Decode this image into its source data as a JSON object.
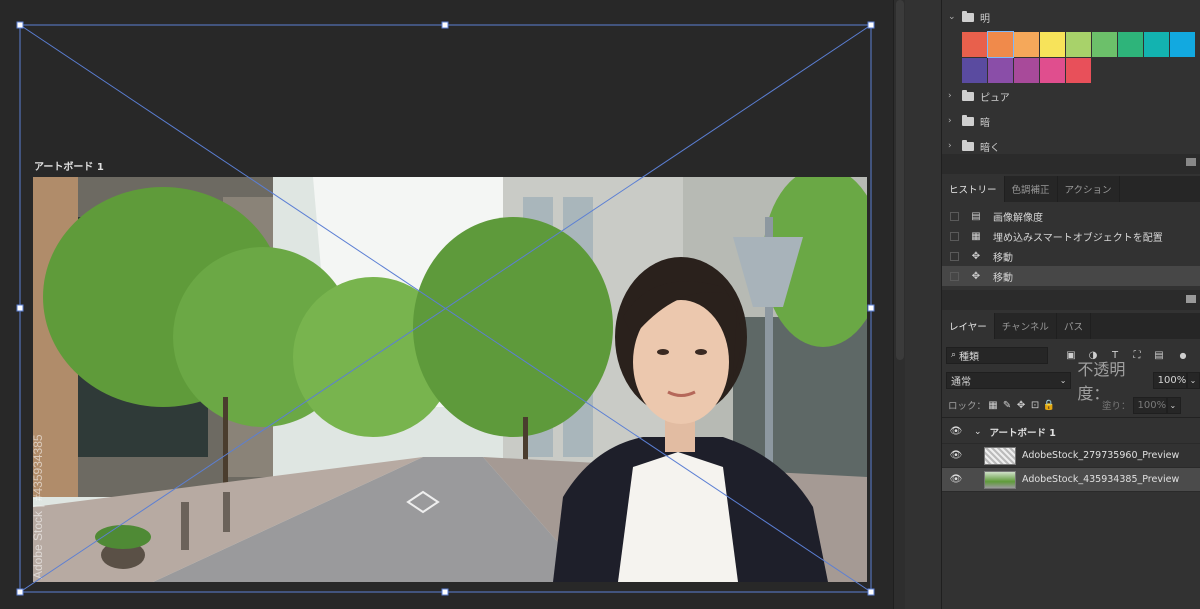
{
  "artboard": {
    "label": "アートボード 1",
    "watermark": "Adobe Stock | #435934385"
  },
  "swatches": {
    "folders": [
      {
        "name": "明",
        "expanded": true
      },
      {
        "name": "ピュア",
        "expanded": false
      },
      {
        "name": "暗",
        "expanded": false
      },
      {
        "name": "暗く",
        "expanded": false
      }
    ],
    "row1": [
      "#e8604c",
      "#f08a4b",
      "#f5a85a",
      "#f7e35a",
      "#a8d26a",
      "#6cc06a",
      "#2eb47a",
      "#13b3b0",
      "#12a9e0"
    ],
    "row2": [
      "#5a4ba0",
      "#8a4ea8",
      "#a84a9a",
      "#e04e8e",
      "#e8505a"
    ]
  },
  "history": {
    "tabs": [
      "ヒストリー",
      "色調補正",
      "アクション"
    ],
    "items": [
      {
        "label": "画像解像度",
        "icon": "document-icon"
      },
      {
        "label": "埋め込みスマートオブジェクトを配置",
        "icon": "place-icon"
      },
      {
        "label": "移動",
        "icon": "move-icon"
      },
      {
        "label": "移動",
        "icon": "move-icon"
      }
    ]
  },
  "layers": {
    "tabs": [
      "レイヤー",
      "チャンネル",
      "パス"
    ],
    "filter_label": "種類",
    "blend_mode": "通常",
    "opacity_label": "不透明度：",
    "opacity_value": "100%",
    "lock_label": "ロック：",
    "fill_label": "塗り：",
    "fill_value": "100%",
    "items": [
      {
        "name": "アートボード 1",
        "type": "artboard"
      },
      {
        "name": "AdobeStock_279735960_Preview",
        "type": "smart-object"
      },
      {
        "name": "AdobeStock_435934385_Preview",
        "type": "smart-object"
      }
    ]
  },
  "colors": {
    "selection": "#5b7fd4",
    "panel": "#323232",
    "canvas": "#282828"
  }
}
